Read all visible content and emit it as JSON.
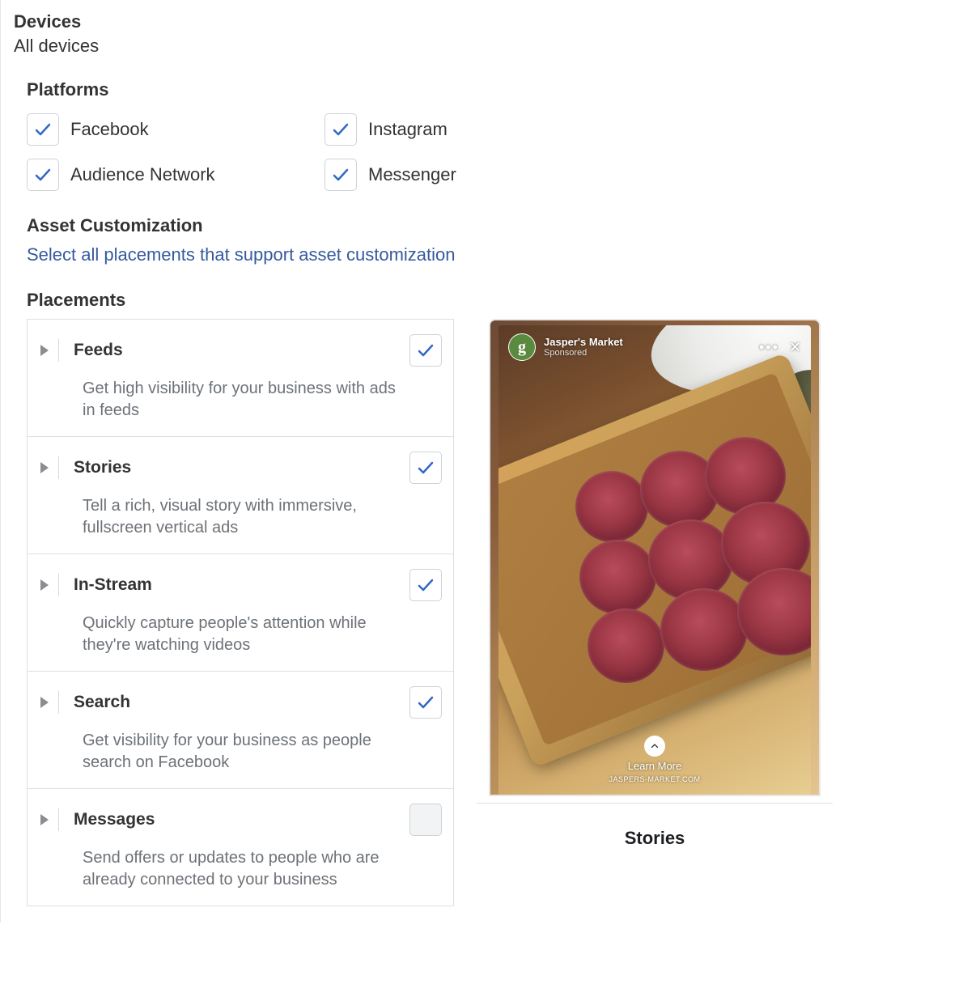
{
  "devices": {
    "heading": "Devices",
    "value": "All devices"
  },
  "platforms": {
    "heading": "Platforms",
    "items": [
      {
        "label": "Facebook",
        "checked": true
      },
      {
        "label": "Instagram",
        "checked": true
      },
      {
        "label": "Audience Network",
        "checked": true
      },
      {
        "label": "Messenger",
        "checked": true
      }
    ]
  },
  "asset_customization": {
    "heading": "Asset Customization",
    "link": "Select all placements that support asset customization"
  },
  "placements": {
    "heading": "Placements",
    "items": [
      {
        "title": "Feeds",
        "desc": "Get high visibility for your business with ads in feeds",
        "checked": true
      },
      {
        "title": "Stories",
        "desc": "Tell a rich, visual story with immersive, fullscreen vertical ads",
        "checked": true
      },
      {
        "title": "In-Stream",
        "desc": "Quickly capture people's attention while they're watching videos",
        "checked": true
      },
      {
        "title": "Search",
        "desc": "Get visibility for your business as people search on Facebook",
        "checked": true
      },
      {
        "title": "Messages",
        "desc": "Send offers or updates to people who are already connected to your business",
        "checked": false
      }
    ]
  },
  "preview": {
    "advertiser": "Jasper's Market",
    "sponsored": "Sponsored",
    "cta": "Learn More",
    "site": "JASPERS-MARKET.COM",
    "label": "Stories"
  },
  "colors": {
    "check_stroke": "#3268c7"
  }
}
